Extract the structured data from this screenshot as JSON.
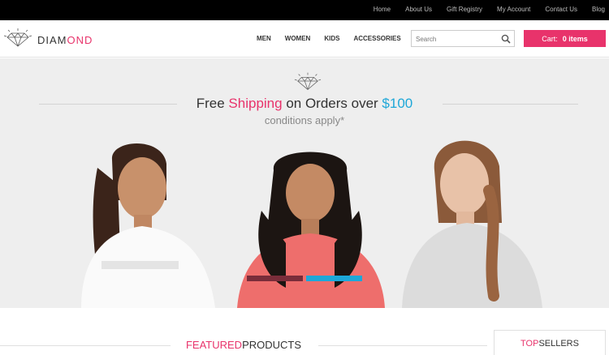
{
  "toplinks": [
    "Home",
    "About Us",
    "Gift Registry",
    "My Account",
    "Contact Us",
    "Blog"
  ],
  "logo": {
    "part1": "DIAM",
    "part2": "OND"
  },
  "nav": [
    "MEN",
    "WOMEN",
    "KIDS",
    "ACCESSORIES"
  ],
  "search": {
    "placeholder": "Search"
  },
  "cart": {
    "label": "Cart:",
    "count": "0 items"
  },
  "hero": {
    "promo_prefix": "Free ",
    "promo_highlight": "Shipping",
    "promo_middle": " on Orders over ",
    "promo_amount": "$100",
    "conditions": "conditions apply*"
  },
  "featured": {
    "highlight": "FEATURED",
    "rest": "PRODUCTS"
  },
  "topsellers": {
    "highlight": "TOP",
    "rest": "SELLERS"
  },
  "colors": {
    "accent": "#e8336b",
    "blue": "#1da7d8",
    "topbar": "#000000",
    "hero_bg": "#eeeeee"
  }
}
